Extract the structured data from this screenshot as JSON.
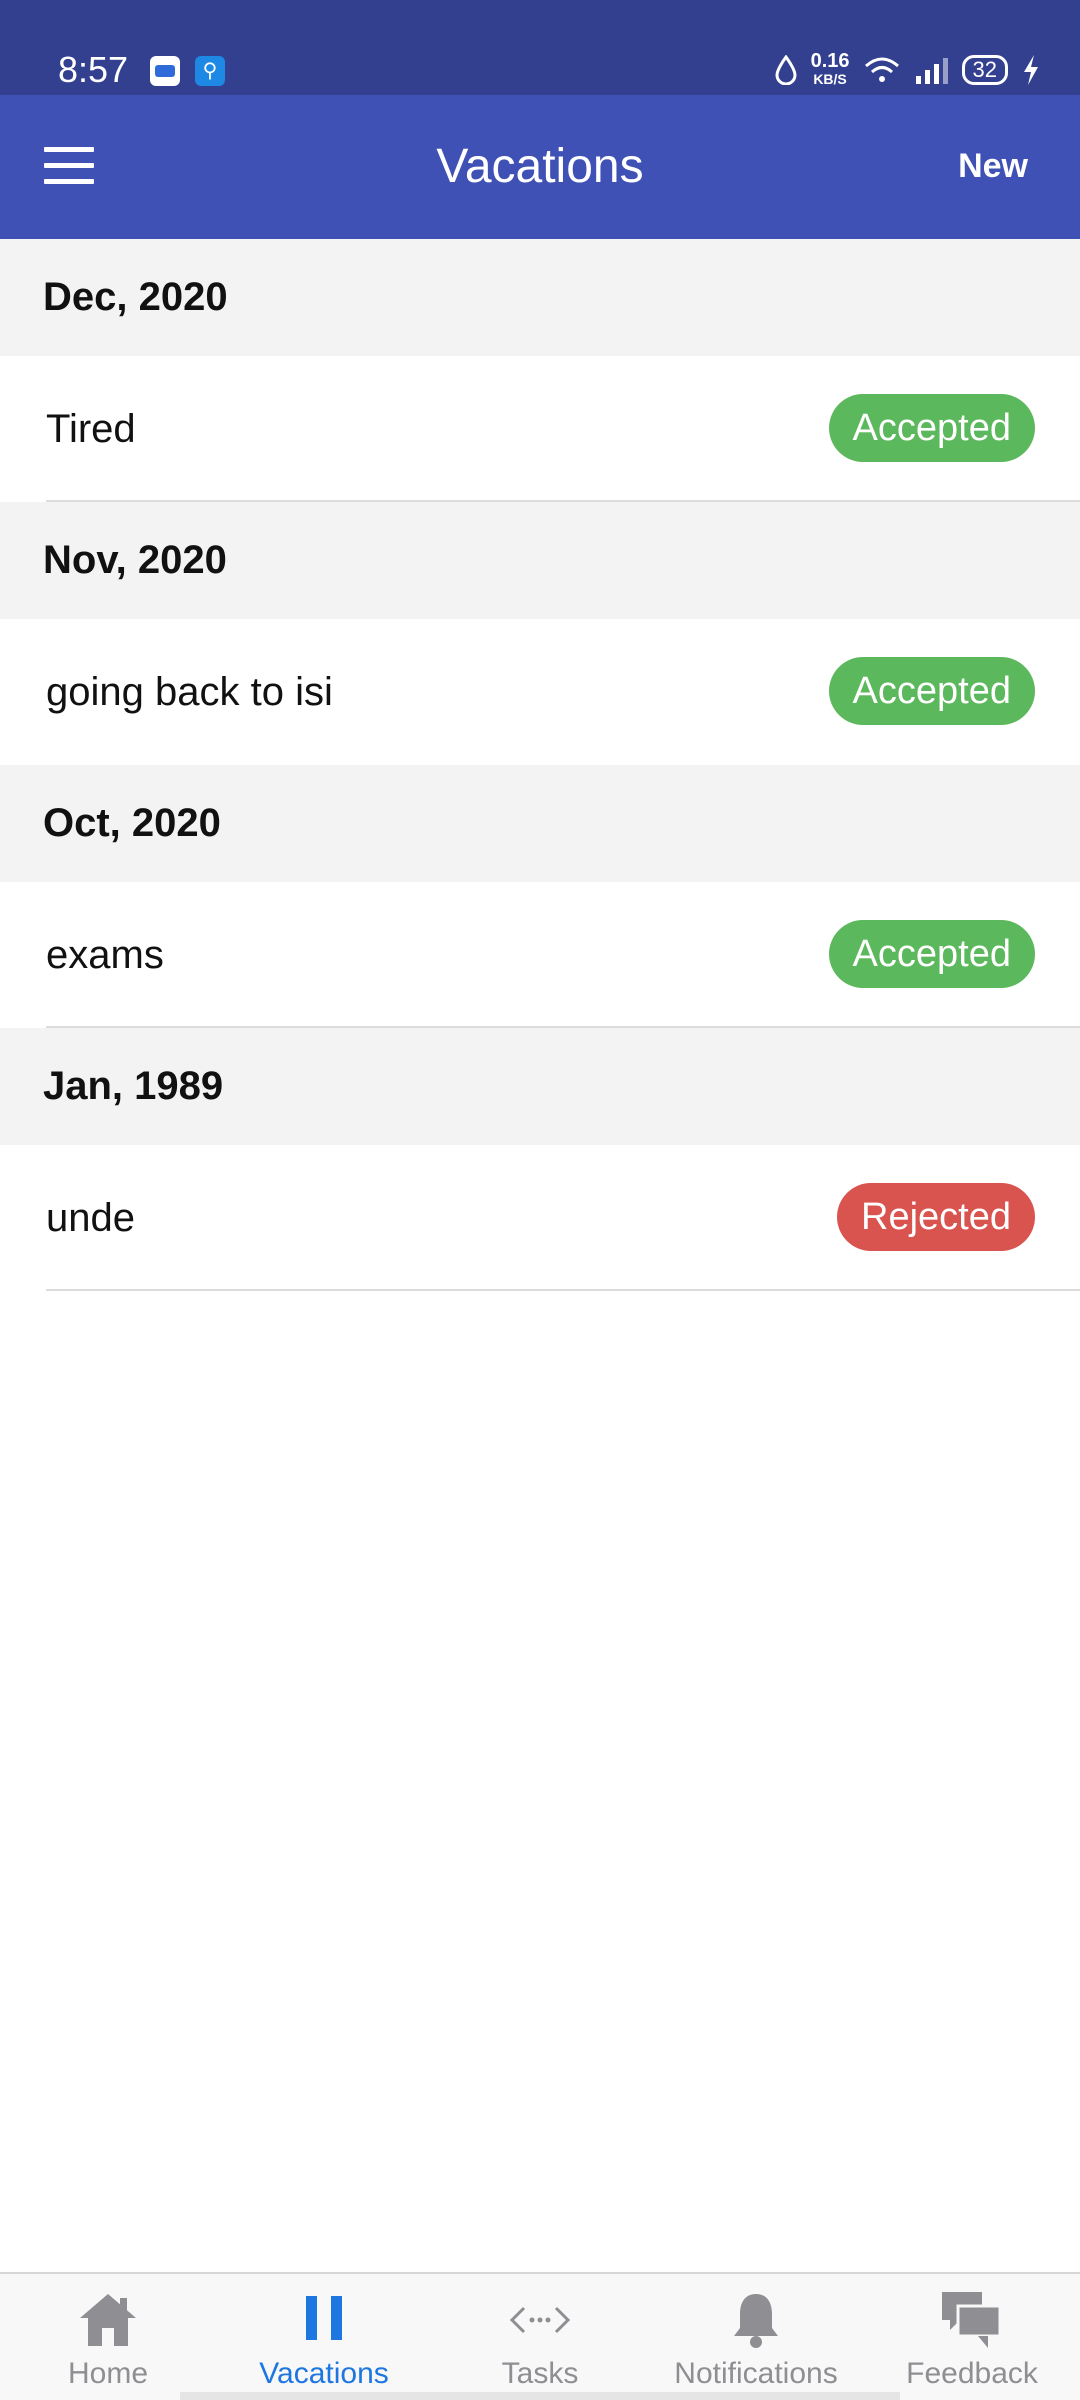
{
  "status_bar": {
    "time": "8:57",
    "net_speed_value": "0.16",
    "net_speed_unit": "KB/S",
    "battery": "32",
    "icons": [
      "notification-app-icon",
      "usb-icon",
      "data-saver-icon",
      "wifi-icon",
      "signal-icon",
      "battery-icon",
      "charging-icon"
    ]
  },
  "appbar": {
    "title": "Vacations",
    "new_label": "New",
    "menu_icon": "hamburger-icon"
  },
  "sections": [
    {
      "header": "Dec, 2020",
      "items": [
        {
          "title": "Tired",
          "status": "Accepted"
        }
      ]
    },
    {
      "header": "Nov, 2020",
      "items": [
        {
          "title": "going back to isi",
          "status": "Accepted"
        }
      ]
    },
    {
      "header": "Oct, 2020",
      "items": [
        {
          "title": "exams",
          "status": "Accepted"
        }
      ]
    },
    {
      "header": "Jan, 1989",
      "items": [
        {
          "title": "unde",
          "status": "Rejected"
        }
      ]
    }
  ],
  "tabs": [
    {
      "label": "Home",
      "icon": "home-icon",
      "active": false
    },
    {
      "label": "Vacations",
      "icon": "pause-icon",
      "active": true
    },
    {
      "label": "Tasks",
      "icon": "code-icon",
      "active": false
    },
    {
      "label": "Notifications",
      "icon": "bell-icon",
      "active": false
    },
    {
      "label": "Feedback",
      "icon": "chat-icon",
      "active": false
    }
  ],
  "colors": {
    "status_bar": "#33408f",
    "appbar": "#3f51b5",
    "accepted": "#5cb85c",
    "rejected": "#d9534f",
    "tab_active": "#1e76e1",
    "tab_inactive": "#8e8e93"
  }
}
